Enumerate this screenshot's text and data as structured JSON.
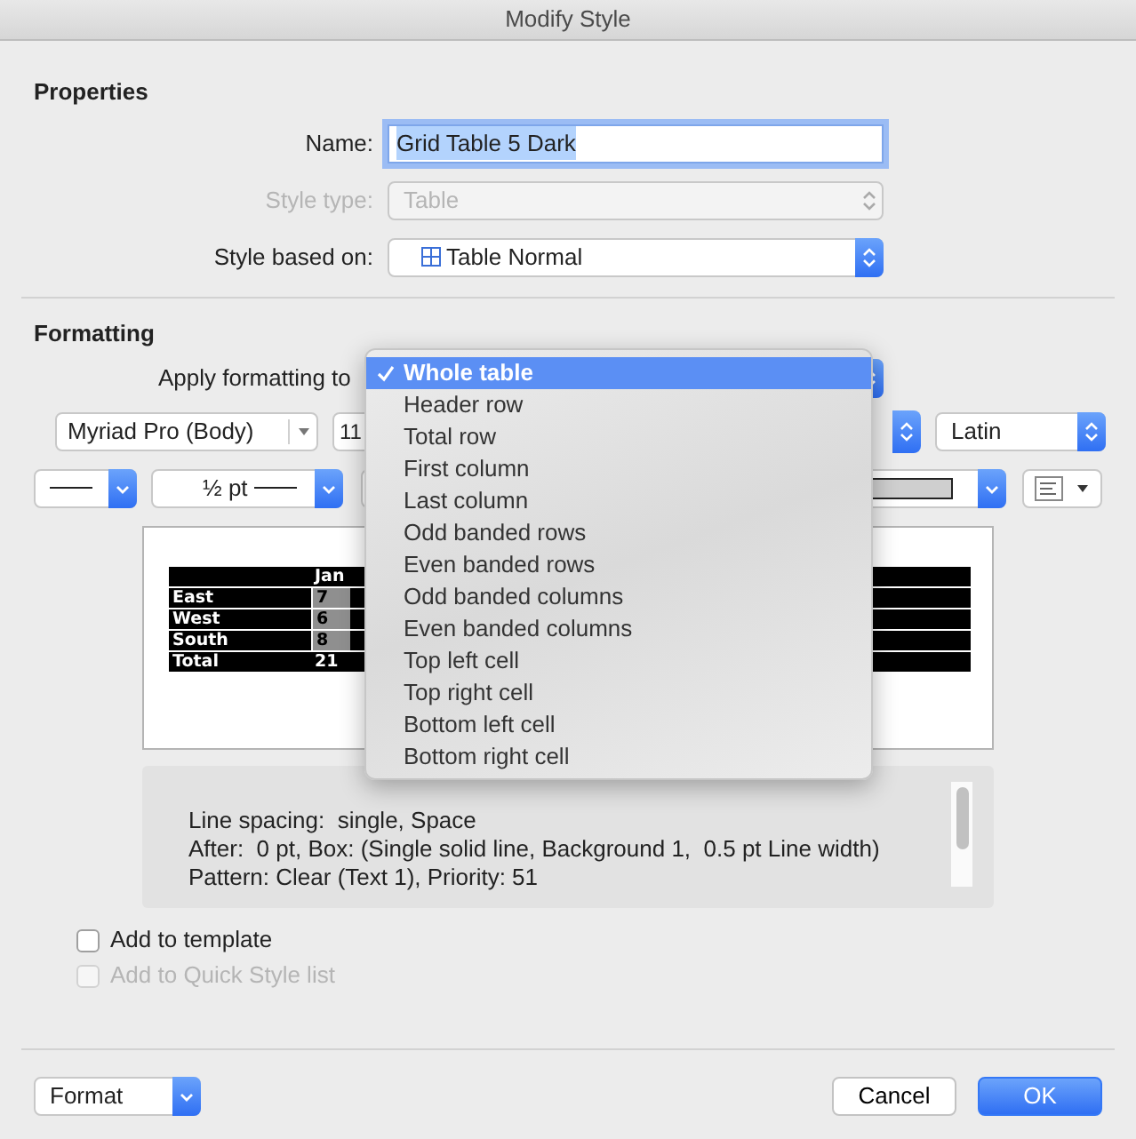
{
  "window": {
    "title": "Modify Style"
  },
  "properties": {
    "heading": "Properties",
    "fields": [
      {
        "label": "Name:",
        "value": "Grid Table 5 Dark",
        "kind": "text",
        "disabled": false,
        "focused": true
      },
      {
        "label": "Style type:",
        "value": "Table",
        "kind": "popup",
        "disabled": true
      },
      {
        "label": "Style based on:",
        "value": "Table Normal",
        "kind": "popup",
        "disabled": false
      }
    ]
  },
  "formatting": {
    "heading": "Formatting",
    "apply_label": "Apply formatting to",
    "menu": [
      {
        "label": "Whole table",
        "selected": true
      },
      {
        "label": "Header row",
        "selected": false
      },
      {
        "label": "Total row",
        "selected": false
      },
      {
        "label": "First column",
        "selected": false
      },
      {
        "label": "Last column",
        "selected": false
      },
      {
        "label": "Odd banded rows",
        "selected": false
      },
      {
        "label": "Even banded rows",
        "selected": false
      },
      {
        "label": "Odd banded columns",
        "selected": false
      },
      {
        "label": "Even banded columns",
        "selected": false
      },
      {
        "label": "Top left cell",
        "selected": false
      },
      {
        "label": "Top right cell",
        "selected": false
      },
      {
        "label": "Bottom left cell",
        "selected": false
      },
      {
        "label": "Bottom right cell",
        "selected": false
      }
    ],
    "font": "Myriad Pro (Body)",
    "size": "11",
    "script": "Latin",
    "line_weight": "½ pt",
    "preview": {
      "header": "Jan",
      "rows": [
        {
          "label": "East",
          "value": "7"
        },
        {
          "label": "West",
          "value": "6"
        },
        {
          "label": "South",
          "value": "8"
        },
        {
          "label": "Total",
          "value": "21"
        }
      ]
    },
    "description": [
      "Line spacing:  single, Space",
      "After:  0 pt, Box: (Single solid line, Background 1,  0.5 pt Line width)",
      "Pattern: Clear (Text 1), Priority: 51"
    ]
  },
  "options": [
    {
      "label": "Add to template",
      "checked": false,
      "disabled": false
    },
    {
      "label": "Add to Quick Style list",
      "checked": false,
      "disabled": true
    }
  ],
  "buttons": {
    "format": "Format",
    "cancel": "Cancel",
    "ok": "OK"
  }
}
